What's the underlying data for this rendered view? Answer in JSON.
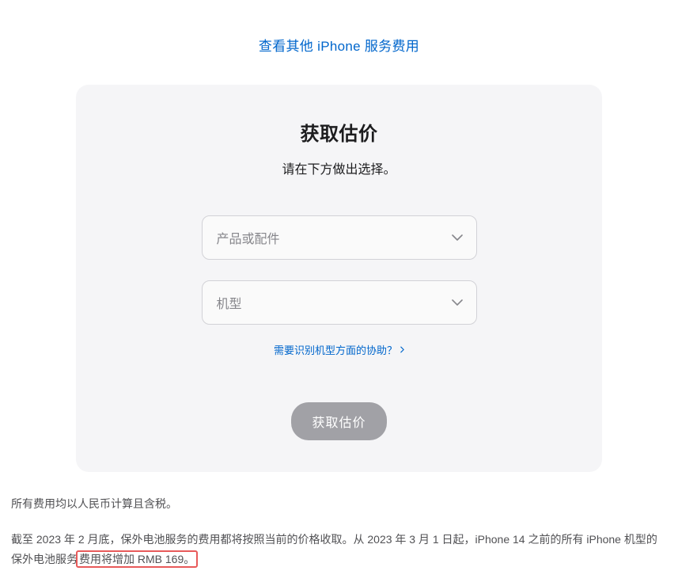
{
  "top_link": {
    "text": "查看其他 iPhone 服务费用"
  },
  "card": {
    "title": "获取估价",
    "subtitle": "请在下方做出选择。",
    "select_product_placeholder": "产品或配件",
    "select_model_placeholder": "机型",
    "help_link_text": "需要识别机型方面的协助？",
    "button_label": "获取估价"
  },
  "footnotes": {
    "note1": "所有费用均以人民币计算且含税。",
    "note2_part1": "截至 2023 年 2 月底，保外电池服务的费用都将按照当前的价格收取。从 2023 年 3 月 1 日起，iPhone 14 之前的所有 iPhone 机型的保外电池服务",
    "note2_highlight": "费用将增加 RMB 169。"
  }
}
